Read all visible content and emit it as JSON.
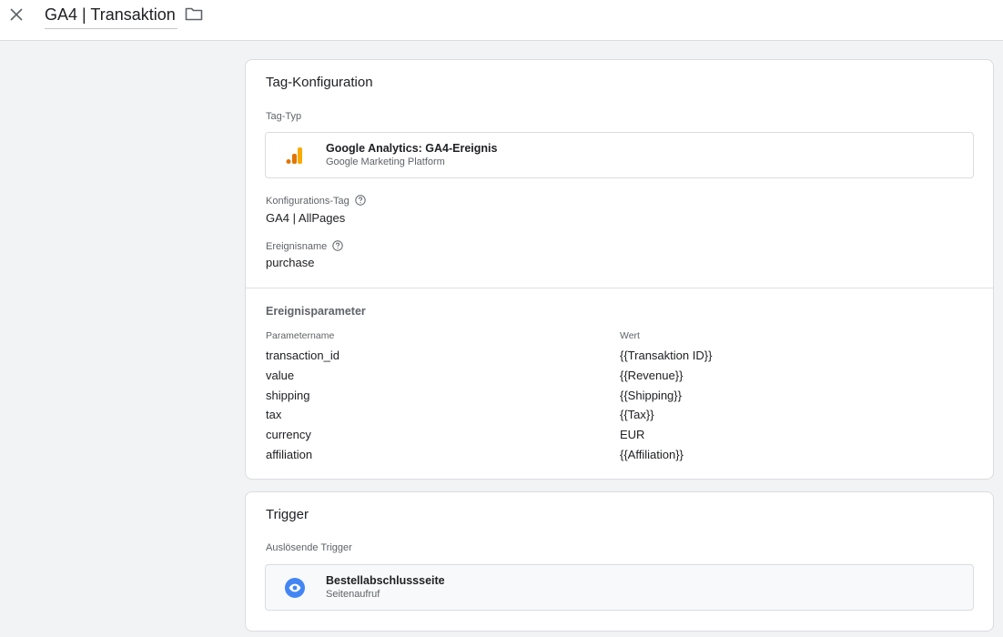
{
  "header": {
    "title": "GA4 | Transaktion"
  },
  "config": {
    "title": "Tag-Konfiguration",
    "tag_type_label": "Tag-Typ",
    "tag_type_name": "Google Analytics: GA4-Ereignis",
    "tag_type_sub": "Google Marketing Platform",
    "config_tag_label": "Konfigurations-Tag",
    "config_tag_value": "GA4 | AllPages",
    "event_name_label": "Ereignisname",
    "event_name_value": "purchase",
    "params_title": "Ereignisparameter",
    "params_header_name": "Parametername",
    "params_header_value": "Wert",
    "params": [
      {
        "name": "transaction_id",
        "value": "{{Transaktion ID}}"
      },
      {
        "name": "value",
        "value": "{{Revenue}}"
      },
      {
        "name": "shipping",
        "value": "{{Shipping}}"
      },
      {
        "name": "tax",
        "value": "{{Tax}}"
      },
      {
        "name": "currency",
        "value": "EUR"
      },
      {
        "name": "affiliation",
        "value": "{{Affiliation}}"
      }
    ]
  },
  "trigger": {
    "title": "Trigger",
    "firing_label": "Auslösende Trigger",
    "name": "Bestellabschlussseite",
    "type": "Seitenaufruf"
  },
  "colors": {
    "analytics_orange": "#f9ab00",
    "analytics_dark_orange": "#e37400",
    "trigger_blue": "#4285f4"
  },
  "icons": {
    "close": "close-icon",
    "folder": "folder-icon",
    "help": "help-circle-icon",
    "analytics": "google-analytics-icon",
    "pageview": "eye-icon"
  }
}
